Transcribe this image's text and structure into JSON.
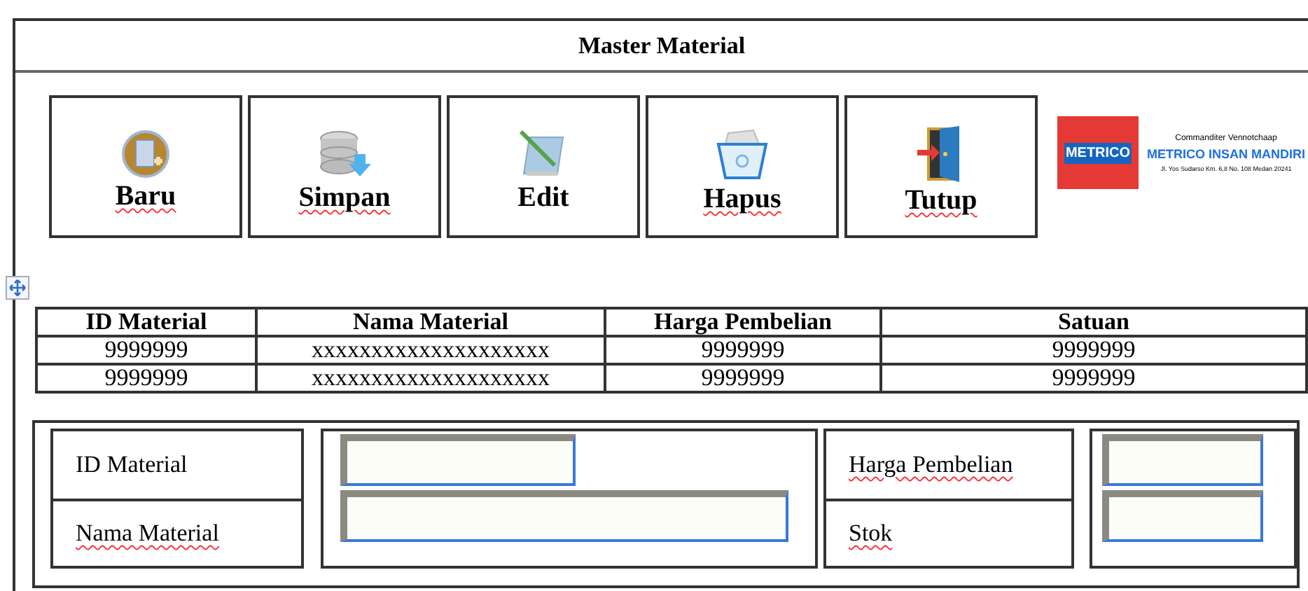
{
  "title": "Master Material",
  "buttons": [
    {
      "label": "Baru",
      "kind": "new",
      "misspelled": true
    },
    {
      "label": "Simpan",
      "kind": "save",
      "misspelled": true
    },
    {
      "label": "Edit",
      "kind": "edit",
      "misspelled": false
    },
    {
      "label": "Hapus",
      "kind": "delete",
      "misspelled": true
    },
    {
      "label": "Tutup",
      "kind": "exit",
      "misspelled": true
    }
  ],
  "logo": {
    "mark": "METRICO",
    "tagline": "Commanditer Vennotchaap",
    "company": "METRICO INSAN MANDIRI",
    "address": "Jl. Yos Sudarso Km. 6,8 No. 108 Medan 20241"
  },
  "table": {
    "columns": [
      "ID Material",
      "Nama Material",
      "Harga Pembelian",
      "Satuan"
    ],
    "rows": [
      [
        "9999999",
        "xxxxxxxxxxxxxxxxxxxx",
        "9999999",
        "9999999"
      ],
      [
        "9999999",
        "xxxxxxxxxxxxxxxxxxxx",
        "9999999",
        "9999999"
      ]
    ]
  },
  "form": {
    "left": [
      {
        "label": "ID Material",
        "misspelled": false,
        "kind": "short"
      },
      {
        "label": "Nama Material",
        "misspelled": true,
        "kind": "long"
      }
    ],
    "right": [
      {
        "label": "Harga Pembelian",
        "misspelled": true,
        "kind": "short"
      },
      {
        "label": "Stok",
        "misspelled": true,
        "kind": "short"
      }
    ]
  }
}
